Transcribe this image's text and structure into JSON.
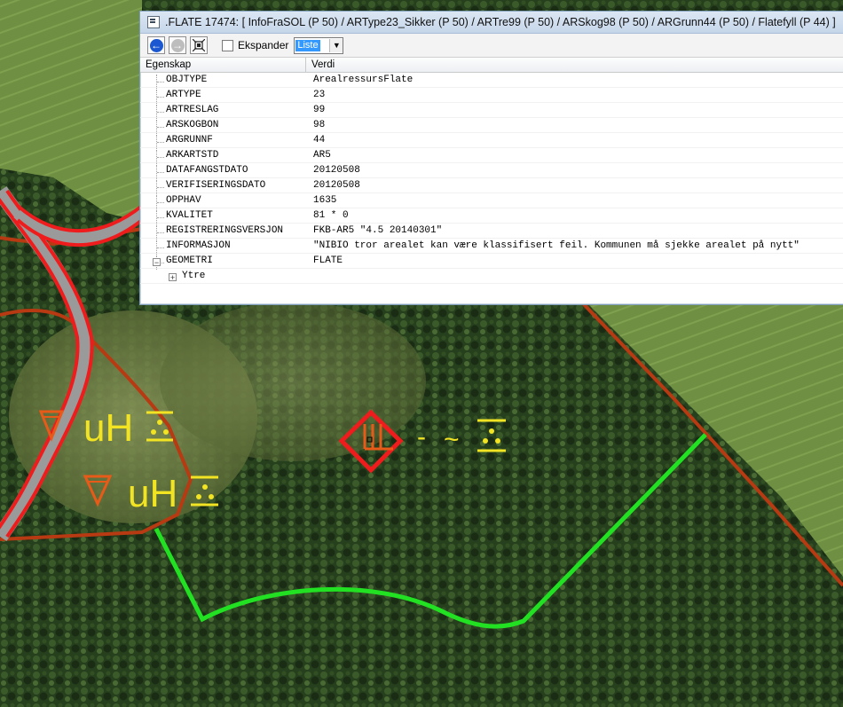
{
  "window": {
    "title": ".FLATE 17474:  [ InfoFraSOL (P 50) / ARType23_Sikker (P 50) / ARTre99 (P 50) / ARSkog98 (P 50) / ARGrunn44 (P 50) / Flatefyll (P 44) ]"
  },
  "toolbar": {
    "expand_label": "Ekspander",
    "view_select_value": "Liste"
  },
  "grid": {
    "col_property": "Egenskap",
    "col_value": "Verdi",
    "rows": [
      {
        "prop": "OBJTYPE",
        "value": "ArealressursFlate"
      },
      {
        "prop": "ARTYPE",
        "value": "23"
      },
      {
        "prop": "ARTRESLAG",
        "value": "99"
      },
      {
        "prop": "ARSKOGBON",
        "value": "98"
      },
      {
        "prop": "ARGRUNNF",
        "value": "44"
      },
      {
        "prop": "ARKARTSTD",
        "value": "AR5"
      },
      {
        "prop": "DATAFANGSTDATO",
        "value": "20120508"
      },
      {
        "prop": "VERIFISERINGSDATO",
        "value": "20120508"
      },
      {
        "prop": "OPPHAV",
        "value": "1635"
      },
      {
        "prop": "KVALITET",
        "value": "81 * 0"
      },
      {
        "prop": "REGISTRERINGSVERSJON",
        "value": "FKB-AR5 \"4.5 20140301\""
      },
      {
        "prop": "INFORMASJON",
        "value": "\"NIBIO tror arealet kan være klassifisert feil. Kommunen må sjekke arealet på nytt\""
      },
      {
        "prop": "GEOMETRI",
        "value": "FLATE"
      }
    ],
    "child": {
      "prop": "Ytre"
    }
  },
  "map": {
    "symbols": {
      "left_top_text": "uH",
      "left_bottom_text": "uH",
      "center_dash": "-",
      "center_tilde": "~"
    },
    "colors": {
      "road": "#ee1c1c",
      "boundary": "#b83a12",
      "selection": "#22e022",
      "symbol": "#f2e422",
      "symbol_orange": "#e85a18",
      "field": "#6e8e3e",
      "forest": "#22361a"
    }
  }
}
